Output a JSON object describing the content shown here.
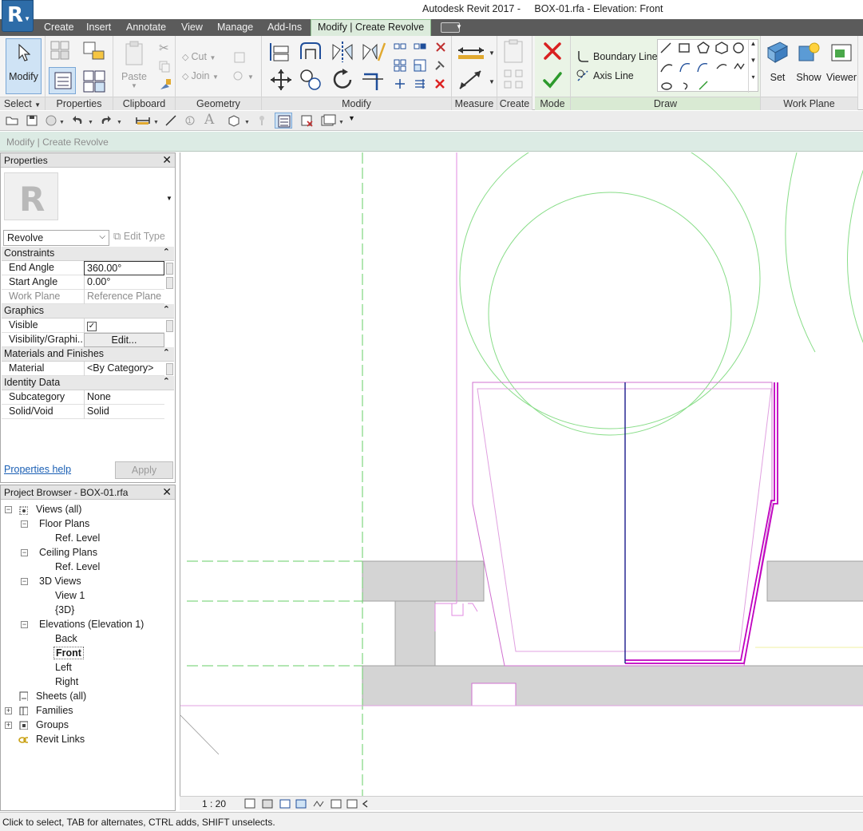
{
  "title": "Autodesk Revit 2017 -     BOX-01.rfa - Elevation: Front",
  "tabs": [
    "Create",
    "Insert",
    "Annotate",
    "View",
    "Manage",
    "Add-Ins",
    "Modify | Create Revolve"
  ],
  "ribbon": {
    "modify_label": "Modify",
    "paste_label": "Paste",
    "cut_label": "Cut",
    "join_label": "Join",
    "boundary_line_label": "Boundary Line",
    "axis_line_label": "Axis Line",
    "set_label": "Set",
    "show_label": "Show",
    "viewer_label": "Viewer",
    "panels": {
      "select": "Select",
      "properties": "Properties",
      "clipboard": "Clipboard",
      "geometry": "Geometry",
      "modify": "Modify",
      "measure": "Measure",
      "create": "Create",
      "mode": "Mode",
      "draw": "Draw",
      "work_plane": "Work Plane"
    }
  },
  "options_bar": {
    "text": "Modify | Create Revolve"
  },
  "properties": {
    "title": "Properties",
    "type": "Revolve",
    "edit_type": "Edit Type",
    "groups": {
      "constraints": "Constraints",
      "graphics": "Graphics",
      "materials": "Materials and Finishes",
      "identity": "Identity Data"
    },
    "rows": {
      "end_angle": {
        "name": "End Angle",
        "value": "360.00°"
      },
      "start_angle": {
        "name": "Start Angle",
        "value": "0.00°"
      },
      "work_plane": {
        "name": "Work Plane",
        "value": "Reference Plane ..."
      },
      "visible": {
        "name": "Visible"
      },
      "visibility": {
        "name": "Visibility/Graphi...",
        "value": "Edit..."
      },
      "material": {
        "name": "Material",
        "value": "<By Category>"
      },
      "subcategory": {
        "name": "Subcategory",
        "value": "None"
      },
      "solid_void": {
        "name": "Solid/Void",
        "value": "Solid"
      }
    },
    "help_link": "Properties help",
    "apply": "Apply"
  },
  "browser": {
    "title": "Project Browser - BOX-01.rfa",
    "nodes": {
      "views": "Views (all)",
      "floor_plans": "Floor Plans",
      "fp_ref": "Ref. Level",
      "ceiling_plans": "Ceiling Plans",
      "cp_ref": "Ref. Level",
      "views_3d": "3D Views",
      "view1": "View 1",
      "v3d": "{3D}",
      "elevations": "Elevations (Elevation 1)",
      "back": "Back",
      "front": "Front",
      "left": "Left",
      "right": "Right",
      "sheets": "Sheets (all)",
      "families": "Families",
      "groups": "Groups",
      "links": "Revit Links"
    }
  },
  "view": {
    "scale": "1 : 20"
  },
  "status": "Click to select, TAB for alternates, CTRL adds, SHIFT unselects.",
  "colors": {
    "accent": "#2d6ca8",
    "sketch_magenta": "#c000c0",
    "ref_green": "#66cc66",
    "axis_blue": "#1a1a8c"
  }
}
